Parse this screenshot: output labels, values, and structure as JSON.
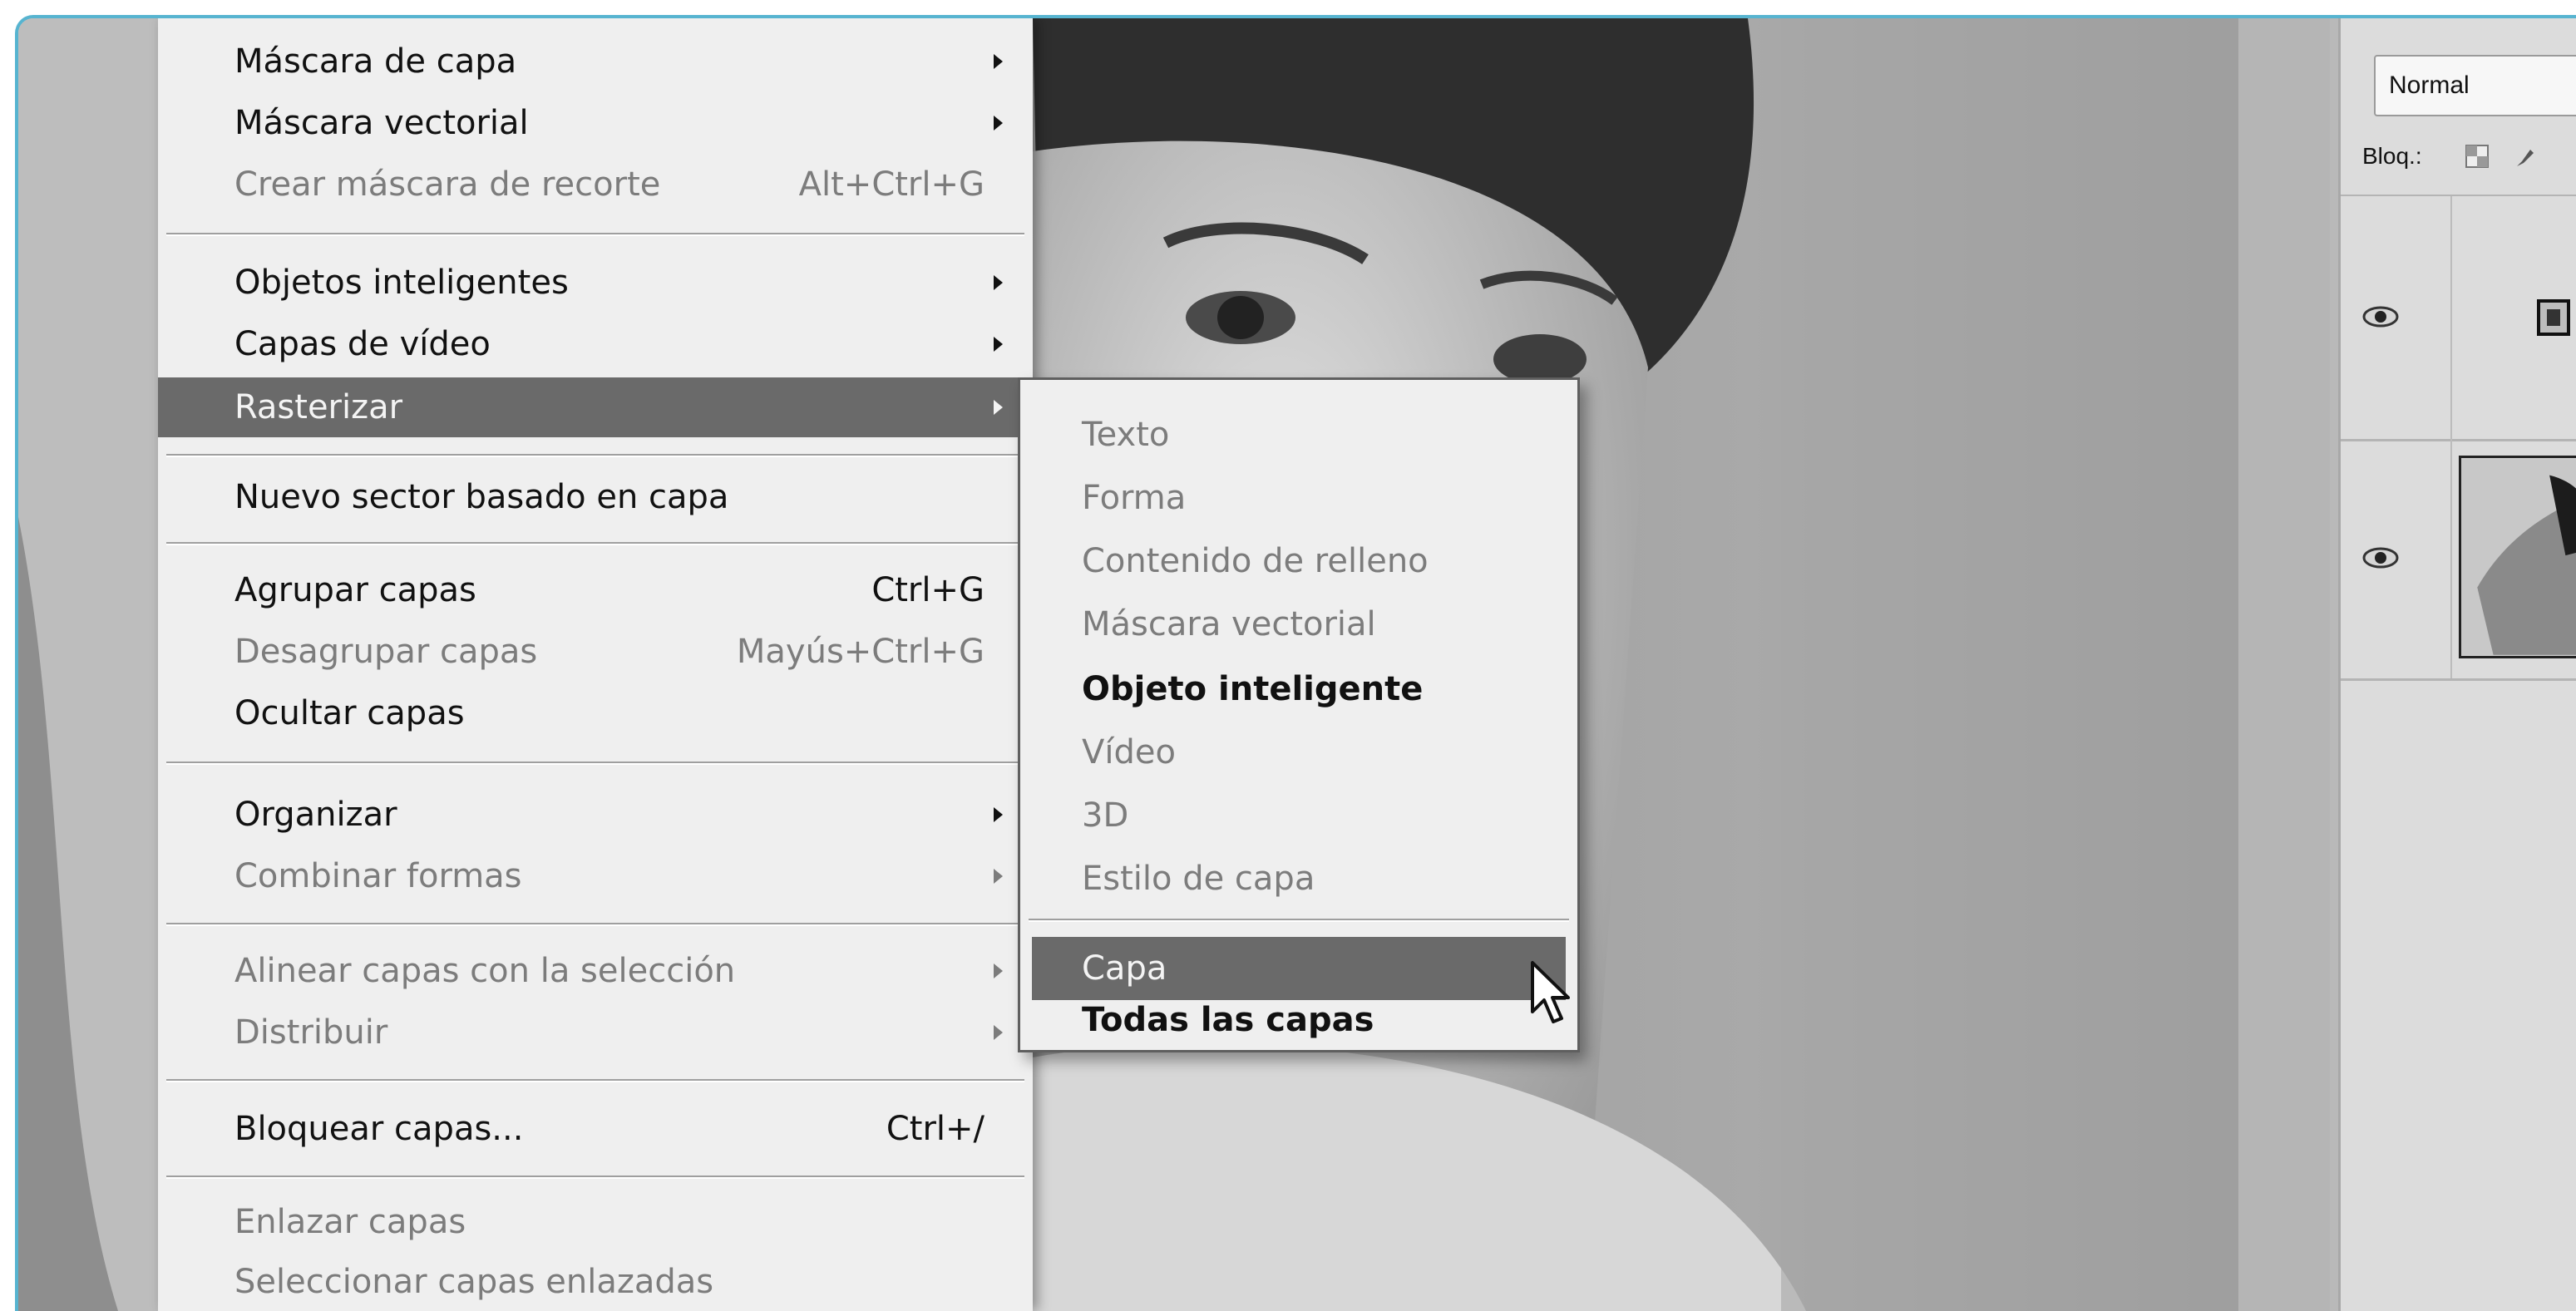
{
  "layer_menu": {
    "items": [
      {
        "label": "Máscara de capa",
        "shortcut": "",
        "submenu": true,
        "enabled": true
      },
      {
        "label": "Máscara vectorial",
        "shortcut": "",
        "submenu": true,
        "enabled": true
      },
      {
        "label": "Crear máscara de recorte",
        "shortcut": "Alt+Ctrl+G",
        "submenu": false,
        "enabled": false
      },
      {
        "label": "Objetos inteligentes",
        "shortcut": "",
        "submenu": true,
        "enabled": true
      },
      {
        "label": "Capas de vídeo",
        "shortcut": "",
        "submenu": true,
        "enabled": true
      },
      {
        "label": "Rasterizar",
        "shortcut": "",
        "submenu": true,
        "enabled": true,
        "highlighted": true
      },
      {
        "label": "Nuevo sector basado en capa",
        "shortcut": "",
        "submenu": false,
        "enabled": true
      },
      {
        "label": "Agrupar capas",
        "shortcut": "Ctrl+G",
        "submenu": false,
        "enabled": true
      },
      {
        "label": "Desagrupar capas",
        "shortcut": "Mayús+Ctrl+G",
        "submenu": false,
        "enabled": false
      },
      {
        "label": "Ocultar capas",
        "shortcut": "",
        "submenu": false,
        "enabled": true
      },
      {
        "label": "Organizar",
        "shortcut": "",
        "submenu": true,
        "enabled": true
      },
      {
        "label": "Combinar formas",
        "shortcut": "",
        "submenu": true,
        "enabled": false
      },
      {
        "label": "Alinear capas con la selección",
        "shortcut": "",
        "submenu": true,
        "enabled": false
      },
      {
        "label": "Distribuir",
        "shortcut": "",
        "submenu": true,
        "enabled": false
      },
      {
        "label": "Bloquear capas...",
        "shortcut": "Ctrl+/",
        "submenu": false,
        "enabled": true
      },
      {
        "label": "Enlazar capas",
        "shortcut": "",
        "submenu": false,
        "enabled": false
      },
      {
        "label": "Seleccionar capas enlazadas",
        "shortcut": "",
        "submenu": false,
        "enabled": false
      }
    ]
  },
  "rasterize_submenu": {
    "items": [
      {
        "label": "Texto",
        "enabled": false
      },
      {
        "label": "Forma",
        "enabled": false
      },
      {
        "label": "Contenido de relleno",
        "enabled": false
      },
      {
        "label": "Máscara vectorial",
        "enabled": false
      },
      {
        "label": "Objeto inteligente",
        "enabled": true
      },
      {
        "label": "Vídeo",
        "enabled": false
      },
      {
        "label": "3D",
        "enabled": false
      },
      {
        "label": "Estilo de capa",
        "enabled": false
      },
      {
        "label": "Capa",
        "enabled": true,
        "highlighted": true
      },
      {
        "label": "Todas las capas",
        "enabled": true
      }
    ]
  },
  "layers_panel": {
    "blend_mode": "Normal",
    "lock_label": "Bloq.:"
  },
  "colors": {
    "frame_border": "#57b4d0",
    "menu_bg": "#efefef",
    "menu_highlight": "#6a6a6a",
    "disabled_text": "#7c7c7c"
  },
  "icons": [
    "submenu-arrow-icon",
    "mouse-cursor-icon",
    "eye-icon",
    "lock-transparent-pixels-icon",
    "lock-brush-icon",
    "layer-thumbnail"
  ]
}
